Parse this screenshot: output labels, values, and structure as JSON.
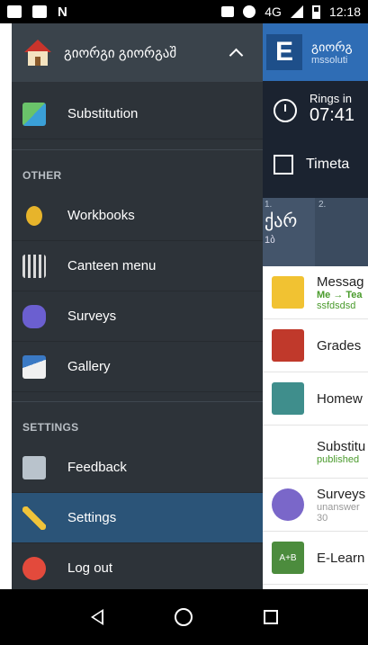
{
  "status_bar": {
    "network": "4G",
    "time": "12:18"
  },
  "app": {
    "header_logo": "E",
    "header_name": "გიორგ",
    "header_sub": "mssoluti",
    "rings_label": "Rings in",
    "rings_time": "07:41",
    "timetable_label": "Timeta",
    "table": {
      "col1_num": "1.",
      "col1_subject": "ქარ",
      "col1_room": "1ბ",
      "col2_num": "2."
    },
    "cards": [
      {
        "title": "Messag",
        "line2": "Me → Tea",
        "line3": "ssfdsdsd",
        "icon": "mail-icon"
      },
      {
        "title": "Grades",
        "icon": "gradebook-icon"
      },
      {
        "title": "Homew",
        "icon": "homework-icon"
      },
      {
        "title": "Substitu",
        "line2": "published",
        "icon": "substitution-icon"
      },
      {
        "title": "Surveys",
        "line2": "unanswer",
        "line3": "30",
        "icon": "surveys-icon"
      },
      {
        "title": "E-Learn",
        "icon": "elearning-icon",
        "badge": "A+B"
      }
    ]
  },
  "drawer": {
    "user_name": "გიორგი გიორგაშ",
    "items": {
      "substitution": "Substitution",
      "workbooks": "Workbooks",
      "canteen": "Canteen menu",
      "surveys": "Surveys",
      "gallery": "Gallery",
      "feedback": "Feedback",
      "settings": "Settings",
      "logout": "Log out"
    },
    "sections": {
      "other": "OTHER",
      "settings": "SETTINGS"
    },
    "active_item": "settings"
  },
  "colors": {
    "drawer_bg": "#2d3339",
    "drawer_header_bg": "#3a434b",
    "active_bg": "#2b5478",
    "app_header_bg": "#2f6db5"
  }
}
